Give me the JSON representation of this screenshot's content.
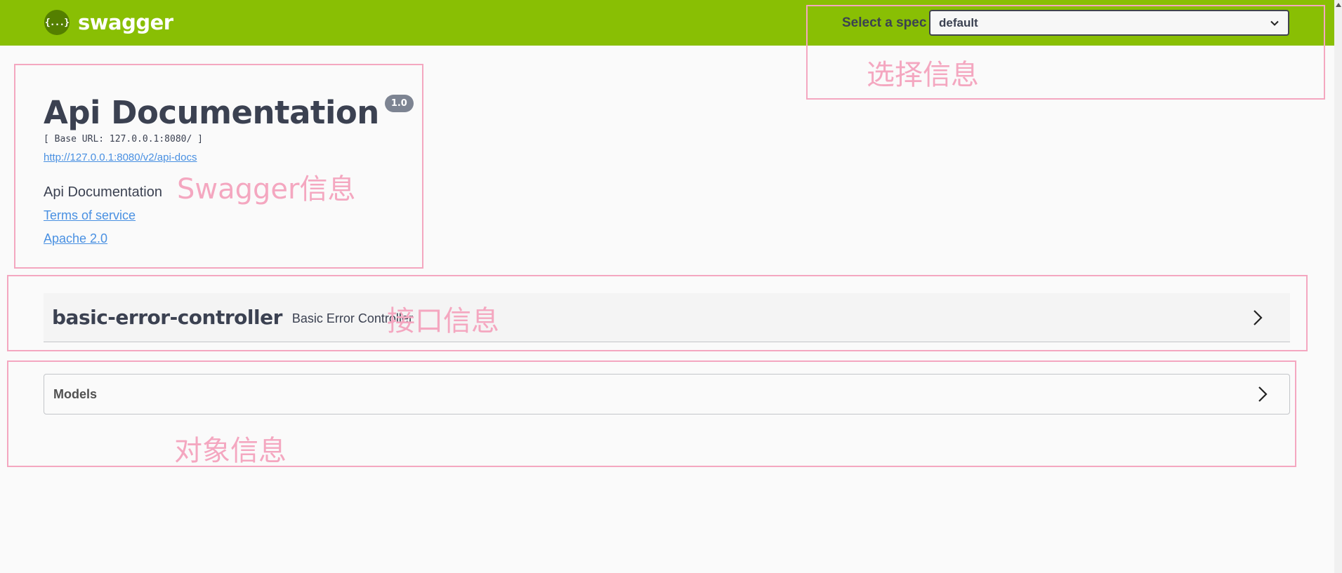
{
  "topbar": {
    "logo_glyph": "{...}",
    "logo_text": "swagger",
    "spec_label": "Select a spec",
    "spec_selected": "default"
  },
  "info": {
    "title": "Api Documentation",
    "version": "1.0",
    "base_url": "[ Base URL: 127.0.0.1:8080/ ]",
    "docs_link": "http://127.0.0.1:8080/v2/api-docs",
    "description": "Api Documentation",
    "terms_link": "Terms of service",
    "license_link": "Apache 2.0"
  },
  "tags": [
    {
      "name": "basic-error-controller",
      "description": "Basic Error Controller"
    }
  ],
  "models": {
    "title": "Models"
  },
  "annotations": {
    "select_spec": "选择信息",
    "swagger_info": "Swagger信息",
    "api_info": "接口信息",
    "model_info": "对象信息",
    "color": "#f4a7c0"
  },
  "colors": {
    "topbar": "#89bf04",
    "link": "#4990e2",
    "text": "#3b4151"
  }
}
